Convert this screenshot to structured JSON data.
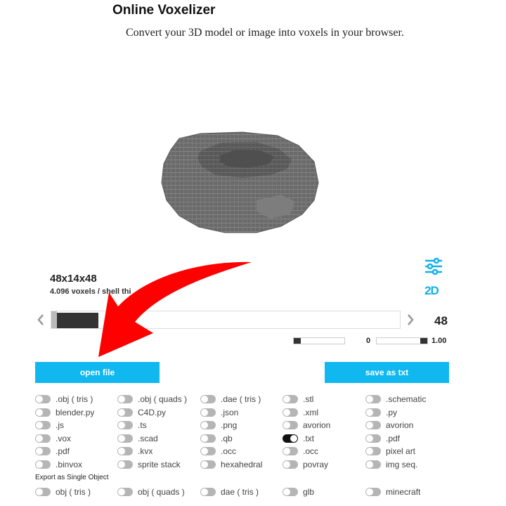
{
  "header": {
    "title": "Online Voxelizer",
    "subtitle": "Convert your 3D model or image into voxels in your browser."
  },
  "model_info": {
    "dimensions": "48x14x48",
    "voxel_count": "4.096 voxels / shell thi"
  },
  "side_icons": {
    "settings": "sliders-icon",
    "mode_2d": "2D"
  },
  "resolution": {
    "value": "48",
    "slider_fill_fraction": 0.12
  },
  "secondary": {
    "left_value": "0",
    "right_value": "1.00",
    "left_fill": 0.0,
    "right_fill": 1.0
  },
  "buttons": {
    "open": "open file",
    "save": "save as txt"
  },
  "formats": [
    [
      ".obj ( tris )",
      ".obj ( quads )",
      ".dae ( tris )",
      ".stl",
      ".schematic"
    ],
    [
      "blender.py",
      "C4D.py",
      ".json",
      ".xml",
      ".py"
    ],
    [
      ".js",
      ".ts",
      ".png",
      "avorion",
      "avorion"
    ],
    [
      ".vox",
      ".scad",
      ".qb",
      ".txt",
      ".pdf"
    ],
    [
      ".pdf",
      ".kvx",
      ".occ",
      ".occ",
      "pixel art"
    ],
    [
      ".binvox",
      "sprite stack",
      "hexahedral",
      "povray",
      "img seq."
    ]
  ],
  "selected_format": ".txt",
  "single_object": {
    "label": "Export as Single Object",
    "options": [
      "obj ( tris )",
      "obj ( quads )",
      "dae ( tris )",
      "glb",
      "minecraft"
    ]
  },
  "colors": {
    "accent": "#11b8f0",
    "arrow": "#ff0000",
    "voxel": "#6b6b6b"
  }
}
